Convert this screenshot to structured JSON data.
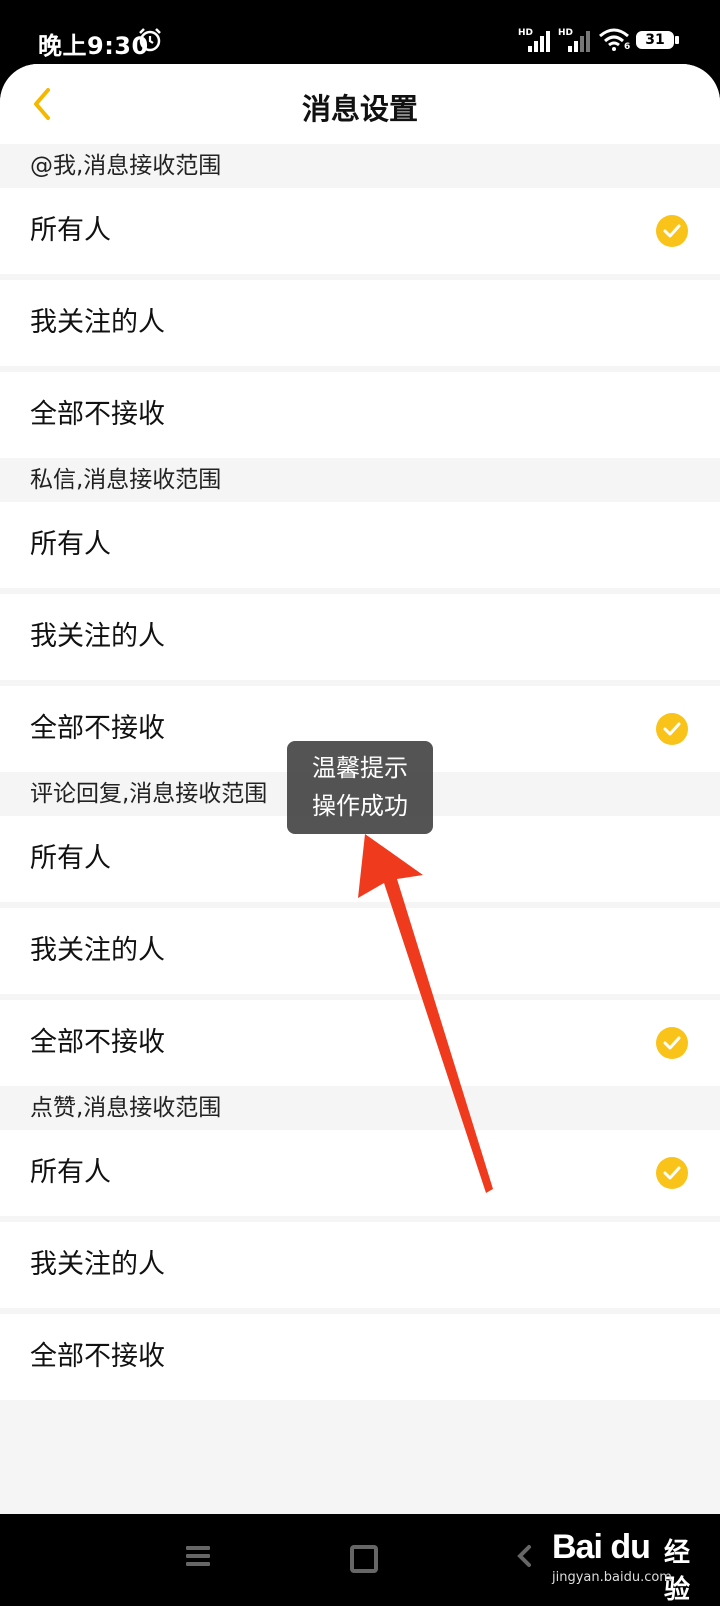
{
  "status_bar": {
    "time": "晚上9:30",
    "signal_label_1": "HD",
    "signal_label_2": "HD",
    "wifi_badge": "6",
    "battery": "31"
  },
  "header": {
    "title": "消息设置",
    "back_icon": "chevron-left-icon"
  },
  "accent_color": "#f9c31a",
  "sections": [
    {
      "title": "@我,消息接收范围",
      "options": [
        {
          "label": "所有人",
          "selected": true
        },
        {
          "label": "我关注的人",
          "selected": false
        },
        {
          "label": "全部不接收",
          "selected": false
        }
      ]
    },
    {
      "title": "私信,消息接收范围",
      "options": [
        {
          "label": "所有人",
          "selected": false
        },
        {
          "label": "我关注的人",
          "selected": false
        },
        {
          "label": "全部不接收",
          "selected": true
        }
      ]
    },
    {
      "title": "评论回复,消息接收范围",
      "options": [
        {
          "label": "所有人",
          "selected": false
        },
        {
          "label": "我关注的人",
          "selected": false
        },
        {
          "label": "全部不接收",
          "selected": true
        }
      ]
    },
    {
      "title": "点赞,消息接收范围",
      "options": [
        {
          "label": "所有人",
          "selected": true
        },
        {
          "label": "我关注的人",
          "selected": false
        },
        {
          "label": "全部不接收",
          "selected": false
        }
      ]
    }
  ],
  "toast": {
    "line1": "温馨提示",
    "line2": "操作成功"
  },
  "watermark": {
    "brand": "Bai du",
    "cn": "经验",
    "site": "jingyan.baidu.com"
  }
}
